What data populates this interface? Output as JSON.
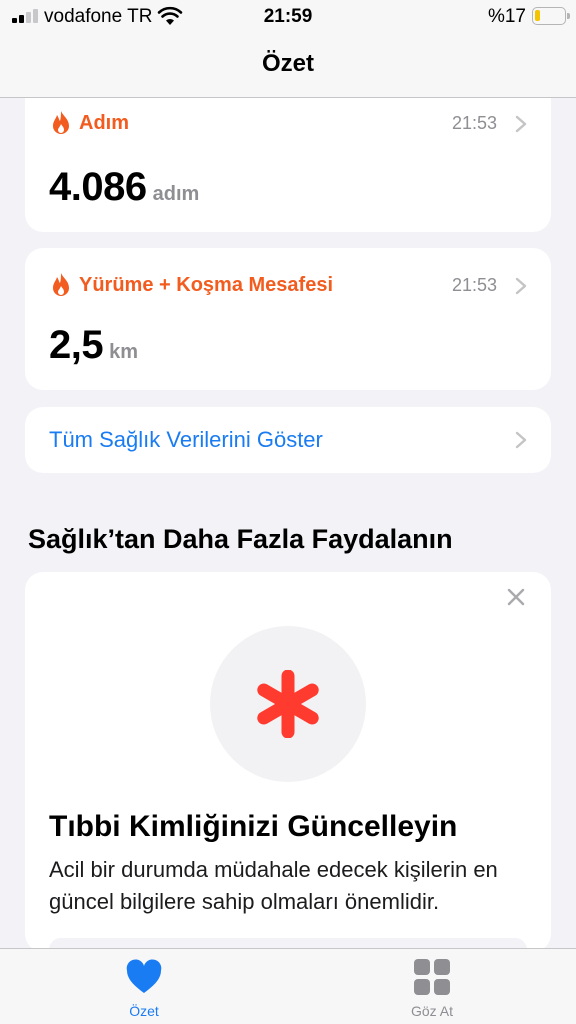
{
  "status_bar": {
    "carrier": "vodafone TR",
    "time": "21:59",
    "battery_percent": "%17",
    "battery_level": 0.17,
    "signal_bars": 2
  },
  "nav": {
    "title": "Özet"
  },
  "cards": [
    {
      "icon": "flame-icon",
      "title": "Adım",
      "time": "21:53",
      "value": "4.086",
      "unit": "adım"
    },
    {
      "icon": "flame-icon",
      "title": "Yürüme + Koşma Mesafesi",
      "time": "21:53",
      "value": "2,5",
      "unit": "km"
    }
  ],
  "all_data_link": {
    "label": "Tüm Sağlık Verilerini Göster"
  },
  "more_section": {
    "title": "Sağlık’tan Daha Fazla Faydalanın",
    "promo": {
      "icon": "medical-asterisk-icon",
      "title": "Tıbbi Kimliğinizi Güncelleyin",
      "body": "Acil bir durumda müdahale edecek kişilerin en güncel bilgilere sahip olmaları önemlidir."
    }
  },
  "tabs": [
    {
      "label": "Özet",
      "icon": "heart-icon",
      "selected": true
    },
    {
      "label": "Göz At",
      "icon": "grid-icon",
      "selected": false
    }
  ],
  "colors": {
    "accent": "#1a7cf2",
    "activity": "#f25c1f",
    "medical": "#ff3b30",
    "secondary_text": "#8e8e93"
  }
}
